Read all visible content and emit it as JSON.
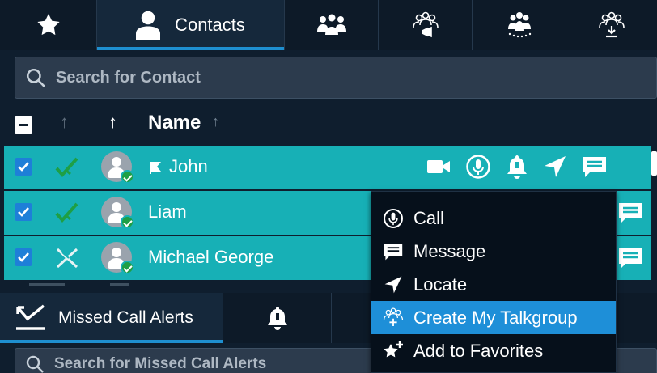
{
  "top_tabs": [
    {
      "icon": "star-icon",
      "label": ""
    },
    {
      "icon": "person-icon",
      "label": "Contacts"
    },
    {
      "icon": "group-icon",
      "label": ""
    },
    {
      "icon": "talkgroup-broadcast-icon",
      "label": ""
    },
    {
      "icon": "talkgroup-dispatch-icon",
      "label": ""
    },
    {
      "icon": "talkgroup-download-icon",
      "label": ""
    }
  ],
  "contacts_search": {
    "placeholder": "Search for Contact",
    "value": ""
  },
  "list_header": {
    "column_name": "Name"
  },
  "contacts": [
    {
      "name": "John",
      "flagged": true,
      "status": "available",
      "selected": true
    },
    {
      "name": "Liam",
      "flagged": false,
      "status": "available",
      "selected": true
    },
    {
      "name": "Michael George",
      "flagged": false,
      "status": "unavailable",
      "selected": true
    }
  ],
  "row_actions": [
    "video-call-icon",
    "ptt-call-icon",
    "alert-bell-icon",
    "locate-icon",
    "message-icon"
  ],
  "context_menu": {
    "items": [
      {
        "label": "Call",
        "icon": "ptt-call-icon",
        "highlighted": false
      },
      {
        "label": "Message",
        "icon": "message-icon",
        "highlighted": false
      },
      {
        "label": "Locate",
        "icon": "locate-icon",
        "highlighted": false
      },
      {
        "label": "Create My Talkgroup",
        "icon": "create-talkgroup-icon",
        "highlighted": true
      },
      {
        "label": "Add to Favorites",
        "icon": "add-favorite-icon",
        "highlighted": false
      }
    ]
  },
  "lower_tabs": [
    {
      "icon": "missed-call-icon",
      "label": "Missed Call Alerts"
    },
    {
      "icon": "bell-icon",
      "label": ""
    },
    {
      "icon": "more-icon",
      "label": ""
    }
  ],
  "alerts_search": {
    "placeholder": "Search for Missed Call Alerts",
    "value": ""
  },
  "colors": {
    "accent": "#1e8fd0",
    "row_selected": "#17b0b6",
    "background": "#0f1e2e",
    "status_green": "#1e9f45"
  }
}
